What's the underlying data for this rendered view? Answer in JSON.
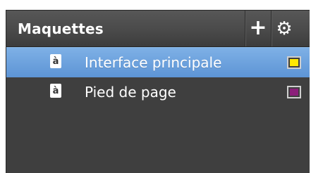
{
  "panel": {
    "title": "Maquettes",
    "add_button_glyph": "+",
    "settings_button_glyph": "⚙",
    "add_icon": "plus-icon",
    "settings_icon": "gear-icon"
  },
  "masters": [
    {
      "label": "Interface principale",
      "icon_glyph": "à",
      "icon": "master-page-icon",
      "color": "#ffe800",
      "selected": true
    },
    {
      "label": "Pied de page",
      "icon_glyph": "à",
      "icon": "master-page-icon",
      "color": "#8b1f7a",
      "selected": false
    }
  ],
  "colors": {
    "panel_background": "#3f3f3f",
    "selection": "#6aa1de",
    "text": "#ffffff"
  }
}
